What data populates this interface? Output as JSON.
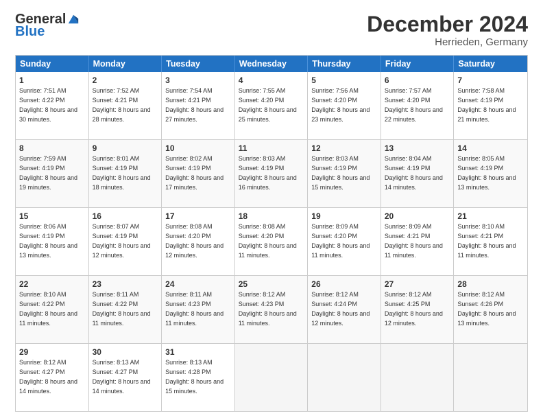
{
  "logo": {
    "general": "General",
    "blue": "Blue"
  },
  "title": "December 2024",
  "location": "Herrieden, Germany",
  "days": [
    "Sunday",
    "Monday",
    "Tuesday",
    "Wednesday",
    "Thursday",
    "Friday",
    "Saturday"
  ],
  "weeks": [
    [
      {
        "day": "1",
        "sunrise": "Sunrise: 7:51 AM",
        "sunset": "Sunset: 4:22 PM",
        "daylight": "Daylight: 8 hours and 30 minutes."
      },
      {
        "day": "2",
        "sunrise": "Sunrise: 7:52 AM",
        "sunset": "Sunset: 4:21 PM",
        "daylight": "Daylight: 8 hours and 28 minutes."
      },
      {
        "day": "3",
        "sunrise": "Sunrise: 7:54 AM",
        "sunset": "Sunset: 4:21 PM",
        "daylight": "Daylight: 8 hours and 27 minutes."
      },
      {
        "day": "4",
        "sunrise": "Sunrise: 7:55 AM",
        "sunset": "Sunset: 4:20 PM",
        "daylight": "Daylight: 8 hours and 25 minutes."
      },
      {
        "day": "5",
        "sunrise": "Sunrise: 7:56 AM",
        "sunset": "Sunset: 4:20 PM",
        "daylight": "Daylight: 8 hours and 23 minutes."
      },
      {
        "day": "6",
        "sunrise": "Sunrise: 7:57 AM",
        "sunset": "Sunset: 4:20 PM",
        "daylight": "Daylight: 8 hours and 22 minutes."
      },
      {
        "day": "7",
        "sunrise": "Sunrise: 7:58 AM",
        "sunset": "Sunset: 4:19 PM",
        "daylight": "Daylight: 8 hours and 21 minutes."
      }
    ],
    [
      {
        "day": "8",
        "sunrise": "Sunrise: 7:59 AM",
        "sunset": "Sunset: 4:19 PM",
        "daylight": "Daylight: 8 hours and 19 minutes."
      },
      {
        "day": "9",
        "sunrise": "Sunrise: 8:01 AM",
        "sunset": "Sunset: 4:19 PM",
        "daylight": "Daylight: 8 hours and 18 minutes."
      },
      {
        "day": "10",
        "sunrise": "Sunrise: 8:02 AM",
        "sunset": "Sunset: 4:19 PM",
        "daylight": "Daylight: 8 hours and 17 minutes."
      },
      {
        "day": "11",
        "sunrise": "Sunrise: 8:03 AM",
        "sunset": "Sunset: 4:19 PM",
        "daylight": "Daylight: 8 hours and 16 minutes."
      },
      {
        "day": "12",
        "sunrise": "Sunrise: 8:03 AM",
        "sunset": "Sunset: 4:19 PM",
        "daylight": "Daylight: 8 hours and 15 minutes."
      },
      {
        "day": "13",
        "sunrise": "Sunrise: 8:04 AM",
        "sunset": "Sunset: 4:19 PM",
        "daylight": "Daylight: 8 hours and 14 minutes."
      },
      {
        "day": "14",
        "sunrise": "Sunrise: 8:05 AM",
        "sunset": "Sunset: 4:19 PM",
        "daylight": "Daylight: 8 hours and 13 minutes."
      }
    ],
    [
      {
        "day": "15",
        "sunrise": "Sunrise: 8:06 AM",
        "sunset": "Sunset: 4:19 PM",
        "daylight": "Daylight: 8 hours and 13 minutes."
      },
      {
        "day": "16",
        "sunrise": "Sunrise: 8:07 AM",
        "sunset": "Sunset: 4:19 PM",
        "daylight": "Daylight: 8 hours and 12 minutes."
      },
      {
        "day": "17",
        "sunrise": "Sunrise: 8:08 AM",
        "sunset": "Sunset: 4:20 PM",
        "daylight": "Daylight: 8 hours and 12 minutes."
      },
      {
        "day": "18",
        "sunrise": "Sunrise: 8:08 AM",
        "sunset": "Sunset: 4:20 PM",
        "daylight": "Daylight: 8 hours and 11 minutes."
      },
      {
        "day": "19",
        "sunrise": "Sunrise: 8:09 AM",
        "sunset": "Sunset: 4:20 PM",
        "daylight": "Daylight: 8 hours and 11 minutes."
      },
      {
        "day": "20",
        "sunrise": "Sunrise: 8:09 AM",
        "sunset": "Sunset: 4:21 PM",
        "daylight": "Daylight: 8 hours and 11 minutes."
      },
      {
        "day": "21",
        "sunrise": "Sunrise: 8:10 AM",
        "sunset": "Sunset: 4:21 PM",
        "daylight": "Daylight: 8 hours and 11 minutes."
      }
    ],
    [
      {
        "day": "22",
        "sunrise": "Sunrise: 8:10 AM",
        "sunset": "Sunset: 4:22 PM",
        "daylight": "Daylight: 8 hours and 11 minutes."
      },
      {
        "day": "23",
        "sunrise": "Sunrise: 8:11 AM",
        "sunset": "Sunset: 4:22 PM",
        "daylight": "Daylight: 8 hours and 11 minutes."
      },
      {
        "day": "24",
        "sunrise": "Sunrise: 8:11 AM",
        "sunset": "Sunset: 4:23 PM",
        "daylight": "Daylight: 8 hours and 11 minutes."
      },
      {
        "day": "25",
        "sunrise": "Sunrise: 8:12 AM",
        "sunset": "Sunset: 4:23 PM",
        "daylight": "Daylight: 8 hours and 11 minutes."
      },
      {
        "day": "26",
        "sunrise": "Sunrise: 8:12 AM",
        "sunset": "Sunset: 4:24 PM",
        "daylight": "Daylight: 8 hours and 12 minutes."
      },
      {
        "day": "27",
        "sunrise": "Sunrise: 8:12 AM",
        "sunset": "Sunset: 4:25 PM",
        "daylight": "Daylight: 8 hours and 12 minutes."
      },
      {
        "day": "28",
        "sunrise": "Sunrise: 8:12 AM",
        "sunset": "Sunset: 4:26 PM",
        "daylight": "Daylight: 8 hours and 13 minutes."
      }
    ],
    [
      {
        "day": "29",
        "sunrise": "Sunrise: 8:12 AM",
        "sunset": "Sunset: 4:27 PM",
        "daylight": "Daylight: 8 hours and 14 minutes."
      },
      {
        "day": "30",
        "sunrise": "Sunrise: 8:13 AM",
        "sunset": "Sunset: 4:27 PM",
        "daylight": "Daylight: 8 hours and 14 minutes."
      },
      {
        "day": "31",
        "sunrise": "Sunrise: 8:13 AM",
        "sunset": "Sunset: 4:28 PM",
        "daylight": "Daylight: 8 hours and 15 minutes."
      },
      null,
      null,
      null,
      null
    ]
  ]
}
